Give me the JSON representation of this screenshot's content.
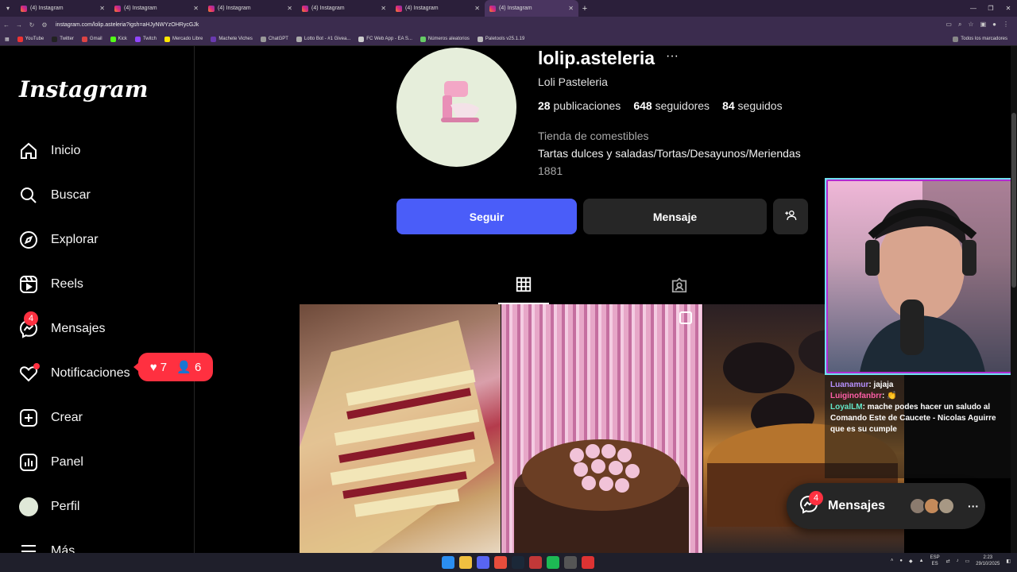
{
  "browser": {
    "tabs": [
      {
        "title": "(4) Instagram"
      },
      {
        "title": "(4) Instagram"
      },
      {
        "title": "(4) Instagram"
      },
      {
        "title": "(4) Instagram"
      },
      {
        "title": "(4) Instagram"
      },
      {
        "title": "(4) Instagram"
      }
    ],
    "url": "instagram.com/lolip.asteleria?igsh=aHJyNWYzOHRycGJk",
    "bookmarks": [
      "YouTube",
      "Twitter",
      "Gmail",
      "Kick",
      "Twitch",
      "Mercado Libre",
      "Machete Viches",
      "ChatGPT",
      "Lotto Bot - #1 Givea...",
      "FC Web App - EA S...",
      "Números aleatorios",
      "Paletools v25.1.19"
    ],
    "bookmarks_right": "Todos los marcadores"
  },
  "sidebar": {
    "logo": "Instagram",
    "items": [
      {
        "label": "Inicio",
        "icon": "home-icon"
      },
      {
        "label": "Buscar",
        "icon": "search-icon"
      },
      {
        "label": "Explorar",
        "icon": "compass-icon"
      },
      {
        "label": "Reels",
        "icon": "reels-icon"
      },
      {
        "label": "Mensajes",
        "icon": "messenger-icon",
        "badge": "4"
      },
      {
        "label": "Notificaciones",
        "icon": "heart-icon"
      },
      {
        "label": "Crear",
        "icon": "plus-square-icon"
      },
      {
        "label": "Panel",
        "icon": "chart-icon"
      },
      {
        "label": "Perfil",
        "icon": "avatar-icon"
      },
      {
        "label": "Más",
        "icon": "menu-icon"
      }
    ],
    "notif_pill": {
      "likes": "7",
      "follows": "6"
    }
  },
  "profile": {
    "username": "lolip.asteleria",
    "more": "···",
    "full_name": "Loli Pasteleria",
    "posts_count": "28",
    "posts_label": "publicaciones",
    "followers_count": "648",
    "followers_label": "seguidores",
    "following_count": "84",
    "following_label": "seguidos",
    "category": "Tienda de comestibles",
    "bio": "Tartas dulces y saladas/Tortas/Desayunos/Meriendas",
    "bio_line2": "1881",
    "follow_btn": "Seguir",
    "message_btn": "Mensaje"
  },
  "stream": {
    "chat": [
      {
        "user": "Luanamur",
        "text": ": jajaja"
      },
      {
        "user": "Luiginofanbrr",
        "text": ": 👏"
      },
      {
        "user": "LoyalLM",
        "text": ": mache podes hacer un saludo al Comando Este de Caucete - Nicolas Aguirre que es su cumple"
      }
    ]
  },
  "floating_messages": {
    "label": "Mensajes",
    "badge": "4",
    "more": "···"
  },
  "taskbar": {
    "lang1": "ESP",
    "lang2": "ES",
    "time": "2:23",
    "date": "29/10/2025"
  },
  "colors": {
    "follow": "#4a5df9",
    "badge": "#ff3040",
    "button_dark": "#262626"
  }
}
